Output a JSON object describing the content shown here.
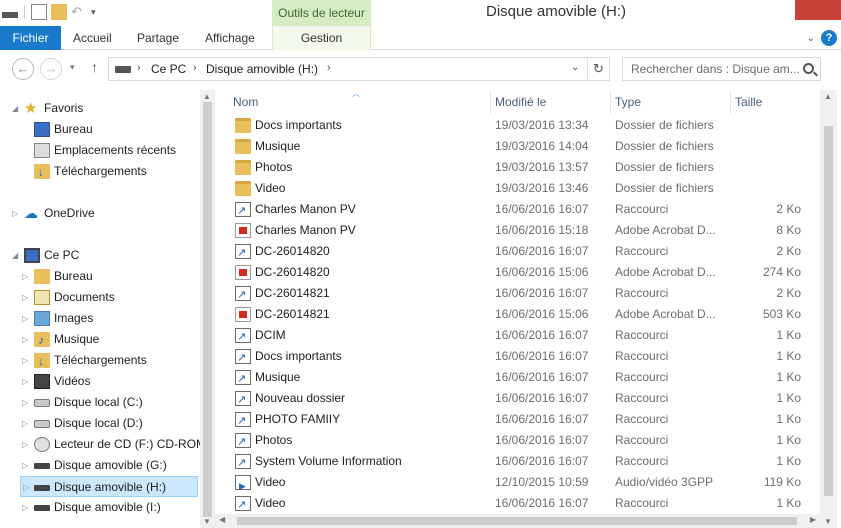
{
  "window": {
    "title": "Disque amovible (H:)",
    "contextual_group": "Outils de lecteur",
    "accent": "#1979ca",
    "close_color": "#c7433a"
  },
  "ribbon": {
    "tabs": [
      "Fichier",
      "Accueil",
      "Partage",
      "Affichage",
      "Gestion"
    ],
    "help_glyph": "?"
  },
  "address": {
    "crumbs": [
      "Ce PC",
      "Disque amovible (H:)"
    ],
    "search_placeholder": "Rechercher dans : Disque am..."
  },
  "nav": {
    "favorites": "Favoris",
    "fav_items": [
      "Bureau",
      "Emplacements récents",
      "Téléchargements"
    ],
    "onedrive": "OneDrive",
    "thispc": "Ce PC",
    "pc_items": [
      "Bureau",
      "Documents",
      "Images",
      "Musique",
      "Téléchargements",
      "Vidéos",
      "Disque local (C:)",
      "Disque local (D:)",
      "Lecteur de CD (F:) CD-ROM",
      "Disque amovible (G:)",
      "Disque amovible (H:)",
      "Disque amovible (I:)"
    ]
  },
  "columns": [
    "Nom",
    "Modifié le",
    "Type",
    "Taille"
  ],
  "files": [
    {
      "name": "Docs importants",
      "date": "19/03/2016 13:34",
      "type": "Dossier de fichiers",
      "size": "",
      "icon": "folder-icon"
    },
    {
      "name": "Musique",
      "date": "19/03/2016 14:04",
      "type": "Dossier de fichiers",
      "size": "",
      "icon": "folder-icon"
    },
    {
      "name": "Photos",
      "date": "19/03/2016 13:57",
      "type": "Dossier de fichiers",
      "size": "",
      "icon": "folder-icon"
    },
    {
      "name": "Video",
      "date": "19/03/2016 13:46",
      "type": "Dossier de fichiers",
      "size": "",
      "icon": "folder-icon"
    },
    {
      "name": "Charles Manon PV",
      "date": "16/06/2016 16:07",
      "type": "Raccourci",
      "size": "2 Ko",
      "icon": "shortcut-icon"
    },
    {
      "name": "Charles Manon PV",
      "date": "16/06/2016 15:18",
      "type": "Adobe Acrobat D...",
      "size": "8 Ko",
      "icon": "pdf-icon"
    },
    {
      "name": "DC-26014820",
      "date": "16/06/2016 16:07",
      "type": "Raccourci",
      "size": "2 Ko",
      "icon": "shortcut-icon"
    },
    {
      "name": "DC-26014820",
      "date": "16/06/2016 15:06",
      "type": "Adobe Acrobat D...",
      "size": "274 Ko",
      "icon": "pdf-icon"
    },
    {
      "name": "DC-26014821",
      "date": "16/06/2016 16:07",
      "type": "Raccourci",
      "size": "2 Ko",
      "icon": "shortcut-icon"
    },
    {
      "name": "DC-26014821",
      "date": "16/06/2016 15:06",
      "type": "Adobe Acrobat D...",
      "size": "503 Ko",
      "icon": "pdf-icon"
    },
    {
      "name": "DCIM",
      "date": "16/06/2016 16:07",
      "type": "Raccourci",
      "size": "1 Ko",
      "icon": "shortcut-icon"
    },
    {
      "name": "Docs importants",
      "date": "16/06/2016 16:07",
      "type": "Raccourci",
      "size": "1 Ko",
      "icon": "shortcut-icon"
    },
    {
      "name": "Musique",
      "date": "16/06/2016 16:07",
      "type": "Raccourci",
      "size": "1 Ko",
      "icon": "shortcut-icon"
    },
    {
      "name": "Nouveau dossier",
      "date": "16/06/2016 16:07",
      "type": "Raccourci",
      "size": "1 Ko",
      "icon": "shortcut-icon"
    },
    {
      "name": "PHOTO FAMIIY",
      "date": "16/06/2016 16:07",
      "type": "Raccourci",
      "size": "1 Ko",
      "icon": "shortcut-icon"
    },
    {
      "name": "Photos",
      "date": "16/06/2016 16:07",
      "type": "Raccourci",
      "size": "1 Ko",
      "icon": "shortcut-icon"
    },
    {
      "name": "System Volume Information",
      "date": "16/06/2016 16:07",
      "type": "Raccourci",
      "size": "1 Ko",
      "icon": "shortcut-icon"
    },
    {
      "name": "Video",
      "date": "12/10/2015 10:59",
      "type": "Audio/vidéo 3GPP",
      "size": "119 Ko",
      "icon": "video-file-icon"
    },
    {
      "name": "Video",
      "date": "16/06/2016 16:07",
      "type": "Raccourci",
      "size": "1 Ko",
      "icon": "shortcut-icon"
    }
  ]
}
